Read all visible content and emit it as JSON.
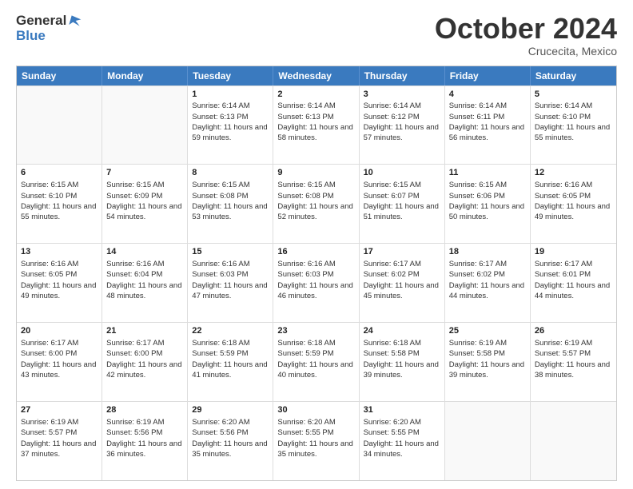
{
  "header": {
    "logo_general": "General",
    "logo_blue": "Blue",
    "month": "October 2024",
    "location": "Crucecita, Mexico"
  },
  "days_of_week": [
    "Sunday",
    "Monday",
    "Tuesday",
    "Wednesday",
    "Thursday",
    "Friday",
    "Saturday"
  ],
  "weeks": [
    [
      {
        "day": "",
        "sunrise": "",
        "sunset": "",
        "daylight": ""
      },
      {
        "day": "",
        "sunrise": "",
        "sunset": "",
        "daylight": ""
      },
      {
        "day": "1",
        "sunrise": "Sunrise: 6:14 AM",
        "sunset": "Sunset: 6:13 PM",
        "daylight": "Daylight: 11 hours and 59 minutes."
      },
      {
        "day": "2",
        "sunrise": "Sunrise: 6:14 AM",
        "sunset": "Sunset: 6:13 PM",
        "daylight": "Daylight: 11 hours and 58 minutes."
      },
      {
        "day": "3",
        "sunrise": "Sunrise: 6:14 AM",
        "sunset": "Sunset: 6:12 PM",
        "daylight": "Daylight: 11 hours and 57 minutes."
      },
      {
        "day": "4",
        "sunrise": "Sunrise: 6:14 AM",
        "sunset": "Sunset: 6:11 PM",
        "daylight": "Daylight: 11 hours and 56 minutes."
      },
      {
        "day": "5",
        "sunrise": "Sunrise: 6:14 AM",
        "sunset": "Sunset: 6:10 PM",
        "daylight": "Daylight: 11 hours and 55 minutes."
      }
    ],
    [
      {
        "day": "6",
        "sunrise": "Sunrise: 6:15 AM",
        "sunset": "Sunset: 6:10 PM",
        "daylight": "Daylight: 11 hours and 55 minutes."
      },
      {
        "day": "7",
        "sunrise": "Sunrise: 6:15 AM",
        "sunset": "Sunset: 6:09 PM",
        "daylight": "Daylight: 11 hours and 54 minutes."
      },
      {
        "day": "8",
        "sunrise": "Sunrise: 6:15 AM",
        "sunset": "Sunset: 6:08 PM",
        "daylight": "Daylight: 11 hours and 53 minutes."
      },
      {
        "day": "9",
        "sunrise": "Sunrise: 6:15 AM",
        "sunset": "Sunset: 6:08 PM",
        "daylight": "Daylight: 11 hours and 52 minutes."
      },
      {
        "day": "10",
        "sunrise": "Sunrise: 6:15 AM",
        "sunset": "Sunset: 6:07 PM",
        "daylight": "Daylight: 11 hours and 51 minutes."
      },
      {
        "day": "11",
        "sunrise": "Sunrise: 6:15 AM",
        "sunset": "Sunset: 6:06 PM",
        "daylight": "Daylight: 11 hours and 50 minutes."
      },
      {
        "day": "12",
        "sunrise": "Sunrise: 6:16 AM",
        "sunset": "Sunset: 6:05 PM",
        "daylight": "Daylight: 11 hours and 49 minutes."
      }
    ],
    [
      {
        "day": "13",
        "sunrise": "Sunrise: 6:16 AM",
        "sunset": "Sunset: 6:05 PM",
        "daylight": "Daylight: 11 hours and 49 minutes."
      },
      {
        "day": "14",
        "sunrise": "Sunrise: 6:16 AM",
        "sunset": "Sunset: 6:04 PM",
        "daylight": "Daylight: 11 hours and 48 minutes."
      },
      {
        "day": "15",
        "sunrise": "Sunrise: 6:16 AM",
        "sunset": "Sunset: 6:03 PM",
        "daylight": "Daylight: 11 hours and 47 minutes."
      },
      {
        "day": "16",
        "sunrise": "Sunrise: 6:16 AM",
        "sunset": "Sunset: 6:03 PM",
        "daylight": "Daylight: 11 hours and 46 minutes."
      },
      {
        "day": "17",
        "sunrise": "Sunrise: 6:17 AM",
        "sunset": "Sunset: 6:02 PM",
        "daylight": "Daylight: 11 hours and 45 minutes."
      },
      {
        "day": "18",
        "sunrise": "Sunrise: 6:17 AM",
        "sunset": "Sunset: 6:02 PM",
        "daylight": "Daylight: 11 hours and 44 minutes."
      },
      {
        "day": "19",
        "sunrise": "Sunrise: 6:17 AM",
        "sunset": "Sunset: 6:01 PM",
        "daylight": "Daylight: 11 hours and 44 minutes."
      }
    ],
    [
      {
        "day": "20",
        "sunrise": "Sunrise: 6:17 AM",
        "sunset": "Sunset: 6:00 PM",
        "daylight": "Daylight: 11 hours and 43 minutes."
      },
      {
        "day": "21",
        "sunrise": "Sunrise: 6:17 AM",
        "sunset": "Sunset: 6:00 PM",
        "daylight": "Daylight: 11 hours and 42 minutes."
      },
      {
        "day": "22",
        "sunrise": "Sunrise: 6:18 AM",
        "sunset": "Sunset: 5:59 PM",
        "daylight": "Daylight: 11 hours and 41 minutes."
      },
      {
        "day": "23",
        "sunrise": "Sunrise: 6:18 AM",
        "sunset": "Sunset: 5:59 PM",
        "daylight": "Daylight: 11 hours and 40 minutes."
      },
      {
        "day": "24",
        "sunrise": "Sunrise: 6:18 AM",
        "sunset": "Sunset: 5:58 PM",
        "daylight": "Daylight: 11 hours and 39 minutes."
      },
      {
        "day": "25",
        "sunrise": "Sunrise: 6:19 AM",
        "sunset": "Sunset: 5:58 PM",
        "daylight": "Daylight: 11 hours and 39 minutes."
      },
      {
        "day": "26",
        "sunrise": "Sunrise: 6:19 AM",
        "sunset": "Sunset: 5:57 PM",
        "daylight": "Daylight: 11 hours and 38 minutes."
      }
    ],
    [
      {
        "day": "27",
        "sunrise": "Sunrise: 6:19 AM",
        "sunset": "Sunset: 5:57 PM",
        "daylight": "Daylight: 11 hours and 37 minutes."
      },
      {
        "day": "28",
        "sunrise": "Sunrise: 6:19 AM",
        "sunset": "Sunset: 5:56 PM",
        "daylight": "Daylight: 11 hours and 36 minutes."
      },
      {
        "day": "29",
        "sunrise": "Sunrise: 6:20 AM",
        "sunset": "Sunset: 5:56 PM",
        "daylight": "Daylight: 11 hours and 35 minutes."
      },
      {
        "day": "30",
        "sunrise": "Sunrise: 6:20 AM",
        "sunset": "Sunset: 5:55 PM",
        "daylight": "Daylight: 11 hours and 35 minutes."
      },
      {
        "day": "31",
        "sunrise": "Sunrise: 6:20 AM",
        "sunset": "Sunset: 5:55 PM",
        "daylight": "Daylight: 11 hours and 34 minutes."
      },
      {
        "day": "",
        "sunrise": "",
        "sunset": "",
        "daylight": ""
      },
      {
        "day": "",
        "sunrise": "",
        "sunset": "",
        "daylight": ""
      }
    ]
  ]
}
